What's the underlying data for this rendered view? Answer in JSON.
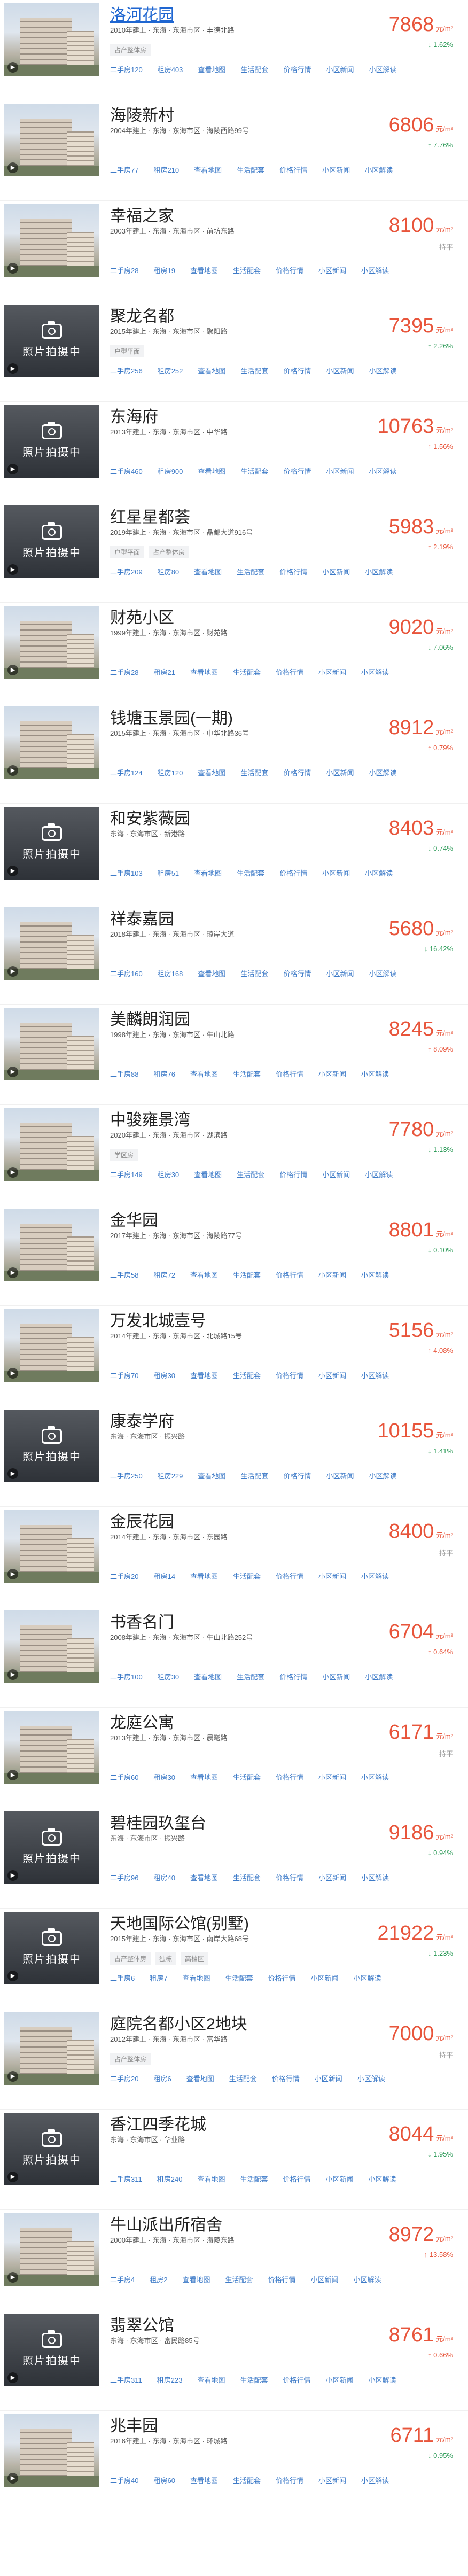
{
  "labels": {
    "price_unit": "元/m²",
    "photo_placeholder": "照片拍摄中",
    "links": [
      "二手房",
      "租房",
      "查看地图",
      "生活配套",
      "价格行情",
      "小区新闻",
      "小区解读"
    ]
  },
  "colors": {
    "price": "#e8553b",
    "link": "#3e7bc8",
    "up": "#e8553b",
    "down": "#2e9b59"
  },
  "items": [
    {
      "name": "洛河花园",
      "meta": "2010年建上 · 东海 · 东海市区 · 丰德北路",
      "tags": [
        "占产整体房"
      ],
      "links": [
        "二手房120",
        "租房403",
        "查看地图",
        "生活配套",
        "价格行情",
        "小区新闻",
        "小区解读"
      ],
      "price": "7868",
      "change": "↓ 1.62%",
      "trend": "down",
      "photo": "building",
      "title_link": true
    },
    {
      "name": "海陵新村",
      "meta": "2004年建上 · 东海 · 东海市区 · 海陵西路99号",
      "tags": [],
      "links": [
        "二手房77",
        "租房210",
        "查看地图",
        "生活配套",
        "价格行情",
        "小区新闻",
        "小区解读"
      ],
      "price": "6806",
      "change": "↑ 7.76%",
      "trend": "down",
      "photo": "building",
      "title_link": false
    },
    {
      "name": "幸福之家",
      "meta": "2003年建上 · 东海 · 东海市区 · 前坊东路",
      "tags": [],
      "links": [
        "二手房28",
        "租房19",
        "查看地图",
        "生活配套",
        "价格行情",
        "小区新闻",
        "小区解读"
      ],
      "price": "8100",
      "change": "持平",
      "trend": "flat",
      "photo": "building",
      "title_link": false
    },
    {
      "name": "聚龙名都",
      "meta": "2015年建上 · 东海 · 东海市区 · 聚阳路",
      "tags": [
        "户型平面"
      ],
      "links": [
        "二手房256",
        "租房252",
        "查看地图",
        "生活配套",
        "价格行情",
        "小区新闻",
        "小区解读"
      ],
      "price": "7395",
      "change": "↑ 2.26%",
      "trend": "down",
      "photo": "placeholder",
      "title_link": false
    },
    {
      "name": "东海府",
      "meta": "2013年建上 · 东海 · 东海市区 · 中华路",
      "tags": [],
      "links": [
        "二手房460",
        "租房900",
        "查看地图",
        "生活配套",
        "价格行情",
        "小区新闻",
        "小区解读"
      ],
      "price": "10763",
      "change": "↑ 1.56%",
      "trend": "up",
      "photo": "placeholder",
      "title_link": false
    },
    {
      "name": "红星星都荟",
      "meta": "2019年建上 · 东海 · 东海市区 · 晶都大道916号",
      "tags": [
        "户型平面",
        "占产整体房"
      ],
      "links": [
        "二手房209",
        "租房80",
        "查看地图",
        "生活配套",
        "价格行情",
        "小区新闻",
        "小区解读"
      ],
      "price": "5983",
      "change": "↑ 2.19%",
      "trend": "up",
      "photo": "placeholder",
      "title_link": false
    },
    {
      "name": "财苑小区",
      "meta": "1999年建上 · 东海 · 东海市区 · 财苑路",
      "tags": [],
      "links": [
        "二手房28",
        "租房21",
        "查看地图",
        "生活配套",
        "价格行情",
        "小区新闻",
        "小区解读"
      ],
      "price": "9020",
      "change": "↓ 7.06%",
      "trend": "down",
      "photo": "building",
      "title_link": false
    },
    {
      "name": "钱塘玉景园(一期)",
      "meta": "2015年建上 · 东海 · 东海市区 · 中华北路36号",
      "tags": [],
      "links": [
        "二手房124",
        "租房120",
        "查看地图",
        "生活配套",
        "价格行情",
        "小区新闻",
        "小区解读"
      ],
      "price": "8912",
      "change": "↑ 0.79%",
      "trend": "up",
      "photo": "building",
      "title_link": false
    },
    {
      "name": "和安紫薇园",
      "meta": "东海 · 东海市区 · 新港路",
      "tags": [],
      "links": [
        "二手房103",
        "租房51",
        "查看地图",
        "生活配套",
        "价格行情",
        "小区新闻",
        "小区解读"
      ],
      "price": "8403",
      "change": "↓ 0.74%",
      "trend": "down",
      "photo": "placeholder",
      "title_link": false
    },
    {
      "name": "祥泰嘉园",
      "meta": "2018年建上 · 东海 · 东海市区 · 琼岸大道",
      "tags": [],
      "links": [
        "二手房160",
        "租房168",
        "查看地图",
        "生活配套",
        "价格行情",
        "小区新闻",
        "小区解读"
      ],
      "price": "5680",
      "change": "↓ 16.42%",
      "trend": "down",
      "photo": "sign",
      "title_link": false
    },
    {
      "name": "美麟朗润园",
      "meta": "1998年建上 · 东海 · 东海市区 · 牛山北路",
      "tags": [],
      "links": [
        "二手房88",
        "租房76",
        "查看地图",
        "生活配套",
        "价格行情",
        "小区新闻",
        "小区解读"
      ],
      "price": "8245",
      "change": "↑ 8.09%",
      "trend": "up",
      "photo": "building",
      "title_link": false
    },
    {
      "name": "中骏雍景湾",
      "meta": "2020年建上 · 东海 · 东海市区 · 湖滨路",
      "tags": [
        "学区房"
      ],
      "links": [
        "二手房149",
        "租房30",
        "查看地图",
        "生活配套",
        "价格行情",
        "小区新闻",
        "小区解读"
      ],
      "price": "7780",
      "change": "↓ 1.13%",
      "trend": "down",
      "photo": "building",
      "title_link": false
    },
    {
      "name": "金华园",
      "meta": "2017年建上 · 东海 · 东海市区 · 海陵路77号",
      "tags": [],
      "links": [
        "二手房58",
        "租房72",
        "查看地图",
        "生活配套",
        "价格行情",
        "小区新闻",
        "小区解读"
      ],
      "price": "8801",
      "change": "↓ 0.10%",
      "trend": "down",
      "photo": "building",
      "title_link": false
    },
    {
      "name": "万发北城壹号",
      "meta": "2014年建上 · 东海 · 东海市区 · 北城路15号",
      "tags": [],
      "links": [
        "二手房70",
        "租房30",
        "查看地图",
        "生活配套",
        "价格行情",
        "小区新闻",
        "小区解读"
      ],
      "price": "5156",
      "change": "↑ 4.08%",
      "trend": "up",
      "photo": "building",
      "title_link": false
    },
    {
      "name": "康泰学府",
      "meta": "东海 · 东海市区 · 振兴路",
      "tags": [],
      "links": [
        "二手房250",
        "租房229",
        "查看地图",
        "生活配套",
        "价格行情",
        "小区新闻",
        "小区解读"
      ],
      "price": "10155",
      "change": "↓ 1.41%",
      "trend": "down",
      "photo": "placeholder",
      "title_link": false
    },
    {
      "name": "金辰花园",
      "meta": "2014年建上 · 东海 · 东海市区 · 东园路",
      "tags": [],
      "links": [
        "二手房20",
        "租房14",
        "查看地图",
        "生活配套",
        "价格行情",
        "小区新闻",
        "小区解读"
      ],
      "price": "8400",
      "change": "持平",
      "trend": "flat",
      "photo": "building",
      "title_link": false
    },
    {
      "name": "书香名门",
      "meta": "2008年建上 · 东海 · 东海市区 · 牛山北路252号",
      "tags": [],
      "links": [
        "二手房100",
        "租房30",
        "查看地图",
        "生活配套",
        "价格行情",
        "小区新闻",
        "小区解读"
      ],
      "price": "6704",
      "change": "↑ 0.64%",
      "trend": "up",
      "photo": "building",
      "title_link": false
    },
    {
      "name": "龙庭公寓",
      "meta": "2013年建上 · 东海 · 东海市区 · 晨曦路",
      "tags": [],
      "links": [
        "二手房60",
        "租房30",
        "查看地图",
        "生活配套",
        "价格行情",
        "小区新闻",
        "小区解读"
      ],
      "price": "6171",
      "change": "持平",
      "trend": "flat",
      "photo": "building",
      "title_link": false
    },
    {
      "name": "碧桂园玖玺台",
      "meta": "东海 · 东海市区 · 振兴路",
      "tags": [],
      "links": [
        "二手房96",
        "租房40",
        "查看地图",
        "生活配套",
        "价格行情",
        "小区新闻",
        "小区解读"
      ],
      "price": "9186",
      "change": "↓ 0.94%",
      "trend": "down",
      "photo": "placeholder",
      "title_link": false
    },
    {
      "name": "天地国际公馆(别墅)",
      "meta": "2015年建上 · 东海 · 东海市区 · 南岸大路68号",
      "tags": [
        "占产整体房",
        "独栋",
        "高档区"
      ],
      "links": [
        "二手房6",
        "租房7",
        "查看地图",
        "生活配套",
        "价格行情",
        "小区新闻",
        "小区解读"
      ],
      "price": "21922",
      "change": "↓ 1.23%",
      "trend": "down",
      "photo": "placeholder",
      "title_link": false
    },
    {
      "name": "庭院名都小区2地块",
      "meta": "2012年建上 · 东海 · 东海市区 · 富华路",
      "tags": [
        "占产整体房"
      ],
      "links": [
        "二手房20",
        "租房6",
        "查看地图",
        "生活配套",
        "价格行情",
        "小区新闻",
        "小区解读"
      ],
      "price": "7000",
      "change": "持平",
      "trend": "flat",
      "photo": "building",
      "title_link": false
    },
    {
      "name": "香江四季花城",
      "meta": "东海 · 东海市区 · 华业路",
      "tags": [],
      "links": [
        "二手房311",
        "租房240",
        "查看地图",
        "生活配套",
        "价格行情",
        "小区新闻",
        "小区解读"
      ],
      "price": "8044",
      "change": "↓ 1.95%",
      "trend": "down",
      "photo": "placeholder",
      "title_link": false
    },
    {
      "name": "牛山派出所宿舍",
      "meta": "2000年建上 · 东海 · 东海市区 · 海陵东路",
      "tags": [],
      "links": [
        "二手房4",
        "租房2",
        "查看地图",
        "生活配套",
        "价格行情",
        "小区新闻",
        "小区解读"
      ],
      "price": "8972",
      "change": "↑ 13.58%",
      "trend": "up",
      "photo": "building",
      "title_link": false
    },
    {
      "name": "翡翠公馆",
      "meta": "东海 · 东海市区 · 富民路85号",
      "tags": [],
      "links": [
        "二手房311",
        "租房223",
        "查看地图",
        "生活配套",
        "价格行情",
        "小区新闻",
        "小区解读"
      ],
      "price": "8761",
      "change": "↑ 0.66%",
      "trend": "up",
      "photo": "placeholder",
      "title_link": false
    },
    {
      "name": "兆丰园",
      "meta": "2016年建上 · 东海 · 东海市区 · 环城路",
      "tags": [],
      "links": [
        "二手房40",
        "租房60",
        "查看地图",
        "生活配套",
        "价格行情",
        "小区新闻",
        "小区解读"
      ],
      "price": "6711",
      "change": "↓ 0.95%",
      "trend": "down",
      "photo": "building",
      "title_link": false
    }
  ]
}
